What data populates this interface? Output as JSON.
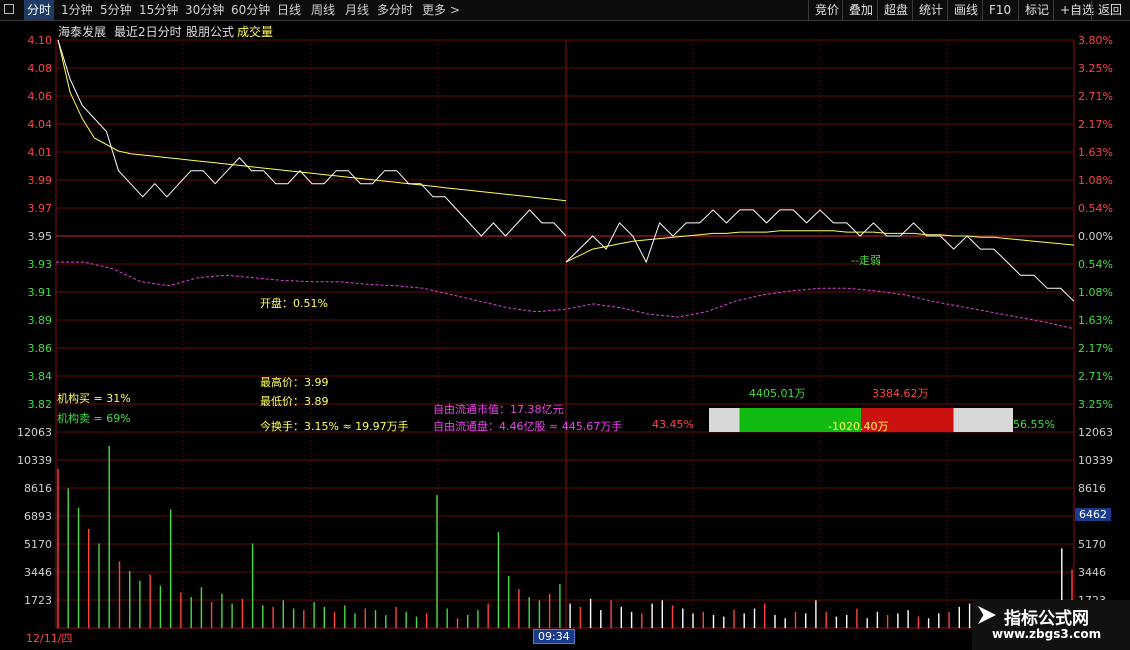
{
  "toolbar": {
    "tabs": [
      "分时",
      "1分钟",
      "5分钟",
      "15分钟",
      "30分钟",
      "60分钟",
      "日线",
      "周线",
      "月线",
      "多分时",
      "更多 >"
    ],
    "buttons": [
      "竞价",
      "叠加",
      "超盘",
      "统计",
      "画线",
      "F10",
      "标记",
      "+自选",
      "返回"
    ]
  },
  "info": {
    "stock": "海泰发展",
    "mode": "最近2日分时",
    "formula": "股朋公式",
    "indicator": "成交量"
  },
  "price_axis": {
    "left_labels": [
      "4.10",
      "4.08",
      "4.06",
      "4.04",
      "4.01",
      "3.99",
      "3.97",
      "3.95",
      "3.93",
      "3.91",
      "3.89",
      "3.86",
      "3.84",
      "3.82"
    ],
    "right_labels": [
      "3.80%",
      "3.25%",
      "2.71%",
      "2.17%",
      "1.63%",
      "1.08%",
      "0.54%",
      "0.00%",
      "0.54%",
      "1.08%",
      "1.63%",
      "2.17%",
      "2.71%",
      "3.25%"
    ]
  },
  "volume_axis": {
    "labels": [
      "12063",
      "10339",
      "8616",
      "6893",
      "5170",
      "3446",
      "1723"
    ],
    "highlight": "6462"
  },
  "annotations": {
    "open": "开盘：0.51%",
    "inst_buy": "机构买 = 31%",
    "inst_sell": "机构卖 = 69%",
    "high": "最高价：3.99",
    "low": "最低价：3.89",
    "turnover": "今换手：3.15% ≈ 19.97万手",
    "float_mcap": "自由流通市值：17.38亿元",
    "float_shares": "自由流通盘：4.46亿股 ≈ 445.67万手",
    "pct_left": "43.45%",
    "pct_right": "56.55%",
    "buy_amount": "4405.01万",
    "sell_amount": "3384.62万",
    "net_amount": "-1020.40万",
    "trend": "--走弱"
  },
  "bottom": {
    "date": "12/11/四",
    "time": "09:34"
  },
  "watermark": {
    "title": "指标公式网",
    "url": "www.zbgs3.com"
  },
  "chart_data": {
    "type": "line",
    "y_price_range": [
      3.8,
      4.1
    ],
    "prev_close": 3.95,
    "price_series_day1": [
      4.1,
      4.07,
      4.05,
      4.04,
      4.03,
      4.0,
      3.99,
      3.98,
      3.99,
      3.98,
      3.99,
      4.0,
      4.0,
      3.99,
      4.0,
      4.01,
      4.0,
      4.0,
      3.99,
      3.99,
      4.0,
      3.99,
      3.99,
      4.0,
      4.0,
      3.99,
      3.99,
      4.0,
      4.0,
      3.99,
      3.99,
      3.98,
      3.98,
      3.97,
      3.96,
      3.95,
      3.96,
      3.95,
      3.96,
      3.97,
      3.96,
      3.96,
      3.95
    ],
    "avg_series_day1": [
      4.1,
      4.06,
      4.04,
      4.025,
      4.02,
      4.015,
      4.013,
      4.012,
      4.011,
      4.01,
      4.009,
      4.008,
      4.007,
      4.006,
      4.005,
      4.004,
      4.003,
      4.002,
      4.001,
      4.0,
      3.999,
      3.998,
      3.997,
      3.996,
      3.995,
      3.994,
      3.993,
      3.992,
      3.991,
      3.99,
      3.989,
      3.988,
      3.987,
      3.986,
      3.985,
      3.984,
      3.983,
      3.982,
      3.981,
      3.98,
      3.979,
      3.978,
      3.977
    ],
    "price_series_day2": [
      3.93,
      3.94,
      3.95,
      3.94,
      3.96,
      3.95,
      3.93,
      3.96,
      3.95,
      3.96,
      3.96,
      3.97,
      3.96,
      3.97,
      3.97,
      3.96,
      3.97,
      3.97,
      3.96,
      3.97,
      3.96,
      3.96,
      3.95,
      3.96,
      3.95,
      3.95,
      3.96,
      3.95,
      3.95,
      3.94,
      3.95,
      3.94,
      3.94,
      3.93,
      3.92,
      3.92,
      3.91,
      3.91,
      3.9
    ],
    "avg_series_day2": [
      3.93,
      3.935,
      3.94,
      3.942,
      3.944,
      3.946,
      3.947,
      3.948,
      3.949,
      3.95,
      3.951,
      3.952,
      3.952,
      3.953,
      3.953,
      3.953,
      3.954,
      3.954,
      3.954,
      3.954,
      3.954,
      3.953,
      3.953,
      3.953,
      3.952,
      3.952,
      3.952,
      3.951,
      3.951,
      3.95,
      3.95,
      3.949,
      3.949,
      3.948,
      3.947,
      3.946,
      3.945,
      3.944,
      3.943
    ],
    "volume_range": [
      0,
      12063
    ],
    "volumes": [
      9800,
      8600,
      7400,
      6100,
      5200,
      11200,
      4100,
      3500,
      2900,
      3300,
      2600,
      7300,
      2200,
      1900,
      2500,
      1600,
      2100,
      1500,
      1800,
      5200,
      1400,
      1300,
      1700,
      1200,
      1100,
      1600,
      1300,
      1000,
      1400,
      900,
      1200,
      1100,
      800,
      1300,
      1000,
      700,
      900,
      8200,
      1200,
      600,
      800,
      1100,
      1500,
      5900,
      3200,
      2400,
      1900,
      1700,
      2100,
      2700,
      1500,
      1300,
      1800,
      1100,
      1700,
      1300,
      1000,
      900,
      1500,
      1700,
      1400,
      1200,
      900,
      1000,
      800,
      700,
      1100,
      900,
      1200,
      1500,
      800,
      600,
      1000,
      900,
      1700,
      1000,
      700,
      800,
      1200,
      600,
      1000,
      800,
      900,
      1100,
      700,
      600,
      900,
      1000,
      1300,
      1500,
      800,
      700,
      1000,
      1200,
      600,
      900,
      800,
      1100,
      4900,
      3600
    ]
  }
}
